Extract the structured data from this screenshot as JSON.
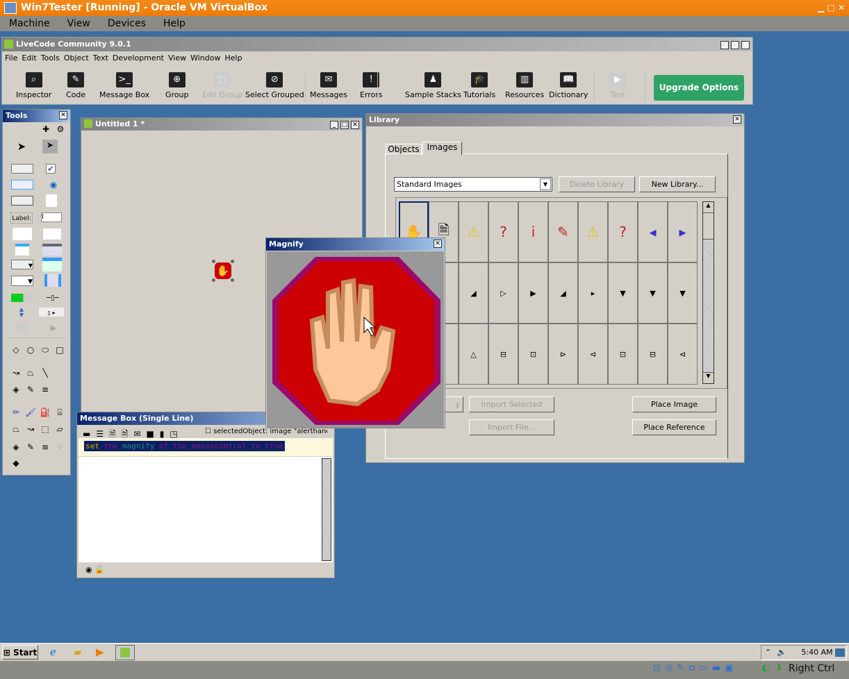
{
  "vbox": {
    "title": "Win7Tester [Running] - Oracle VM VirtualBox",
    "menu": [
      "Machine",
      "View",
      "Devices",
      "Help"
    ],
    "host_key": "Right Ctrl"
  },
  "livecode": {
    "title": "LiveCode Community 9.0.1",
    "menu": [
      "File",
      "Edit",
      "Tools",
      "Object",
      "Text",
      "Development",
      "View",
      "Window",
      "Help"
    ],
    "toolbar": [
      {
        "label": "Inspector",
        "icon": "inspector-icon",
        "g": "⌕"
      },
      {
        "label": "Code",
        "icon": "code-icon",
        "g": "✎"
      },
      {
        "label": "Message Box",
        "icon": "message-box-icon",
        "g": ">_"
      },
      {
        "label": "Group",
        "icon": "group-icon",
        "g": "⊕"
      },
      {
        "label": "Edit Group",
        "icon": "edit-group-icon",
        "g": "⬚",
        "disabled": true
      },
      {
        "label": "Select Grouped",
        "icon": "select-grouped-icon",
        "g": "⊘"
      },
      {
        "label": "Messages",
        "icon": "envelope-icon",
        "g": "✉"
      },
      {
        "label": "Errors",
        "icon": "warning-icon",
        "g": "!"
      },
      {
        "label": "Sample Stacks",
        "icon": "people-icon",
        "g": "♟"
      },
      {
        "label": "Tutorials",
        "icon": "mortarboard-icon",
        "g": "🎓"
      },
      {
        "label": "Resources",
        "icon": "books-icon",
        "g": "▥"
      },
      {
        "label": "Dictionary",
        "icon": "book-icon",
        "g": "📖"
      },
      {
        "label": "Test",
        "icon": "play-icon",
        "g": "▶",
        "disabled": true
      }
    ],
    "upgrade": "Upgrade Options"
  },
  "tools": {
    "title": "Tools",
    "label_tool": "Label:"
  },
  "stack": {
    "title": "Untitled 1 *"
  },
  "library": {
    "title": "Library",
    "tabs": [
      "Objects",
      "Images"
    ],
    "active_tab": "Images",
    "library_select": "Standard Images",
    "delete_library": "Delete Library",
    "new_library": "New Library...",
    "import_selected": "Import Selected",
    "import_file": "Import File...",
    "place_image": "Place Image",
    "place_reference": "Place Reference",
    "hidden_button_fragment": "y",
    "images": [
      [
        "✋",
        "🗎",
        "⚠",
        "?",
        "i",
        "✎",
        "⚠",
        "?",
        "◂",
        "▸"
      ],
      [
        "",
        "",
        "◢",
        "▷",
        "▶",
        "◢",
        "▸",
        "▼",
        "▼",
        "▼"
      ],
      [
        "",
        "",
        "△",
        "⊟",
        "⊡",
        "⊳",
        "⊲",
        "⊡",
        "⊟",
        "⊲"
      ]
    ]
  },
  "magnify": {
    "title": "Magnify"
  },
  "message_box": {
    "title": "Message Box (Single Line)",
    "selected_object": "selectedObject: image \"alerthand.",
    "command": {
      "keyword": "set",
      "rest1": " the ",
      "prop": "magnify",
      "rest2": " of the mousecontrol to true"
    }
  },
  "taskbar": {
    "start": "Start",
    "clock": "5:40 AM"
  },
  "colors": {
    "vbox_orange": "#ee7b07",
    "upgrade_green": "#2fa265",
    "desktop": "#3a6ea5",
    "active_title": "#0a246a"
  }
}
